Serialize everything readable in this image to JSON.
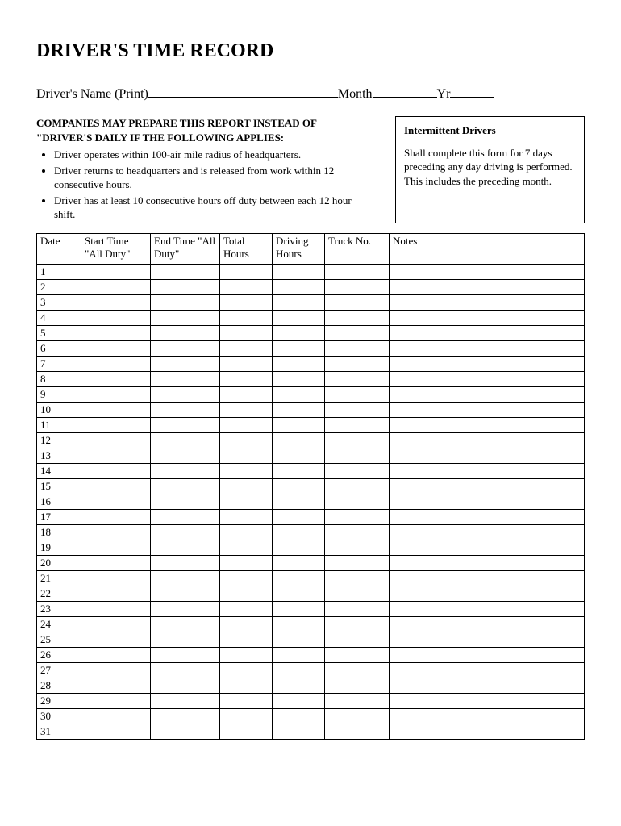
{
  "title": "DRIVER'S TIME RECORD",
  "header": {
    "name_label": "Driver's Name (Print) ",
    "month_label": "Month",
    "yr_label": "Yr"
  },
  "subhead": {
    "line1": "COMPANIES MAY PREPARE THIS REPORT INSTEAD OF",
    "line2": " \"DRIVER'S DAILY IF THE FOLLOWING APPLIES:"
  },
  "bullets": [
    "Driver operates within 100-air mile radius of headquarters.",
    "Driver returns to headquarters and is released from work within 12 consecutive hours.",
    "Driver has at least 10 consecutive hours off duty between each 12 hour shift."
  ],
  "box": {
    "title": "Intermittent Drivers",
    "body": "Shall complete this form for 7 days preceding any day driving is performed.  This includes the preceding month."
  },
  "columns": {
    "date": "Date",
    "start": "Start Time \"All Duty\"",
    "end": "End Time \"All Duty\"",
    "total": "Total Hours",
    "driving": "Driving Hours",
    "truck": "Truck No.",
    "notes": "Notes"
  },
  "rows": [
    "1",
    "2",
    "3",
    "4",
    "5",
    "6",
    "7",
    "8",
    "9",
    "10",
    "11",
    "12",
    "13",
    "14",
    "15",
    "16",
    "17",
    "18",
    "19",
    "20",
    "21",
    "22",
    "23",
    "24",
    "25",
    "26",
    "27",
    "28",
    "29",
    "30",
    "31"
  ]
}
